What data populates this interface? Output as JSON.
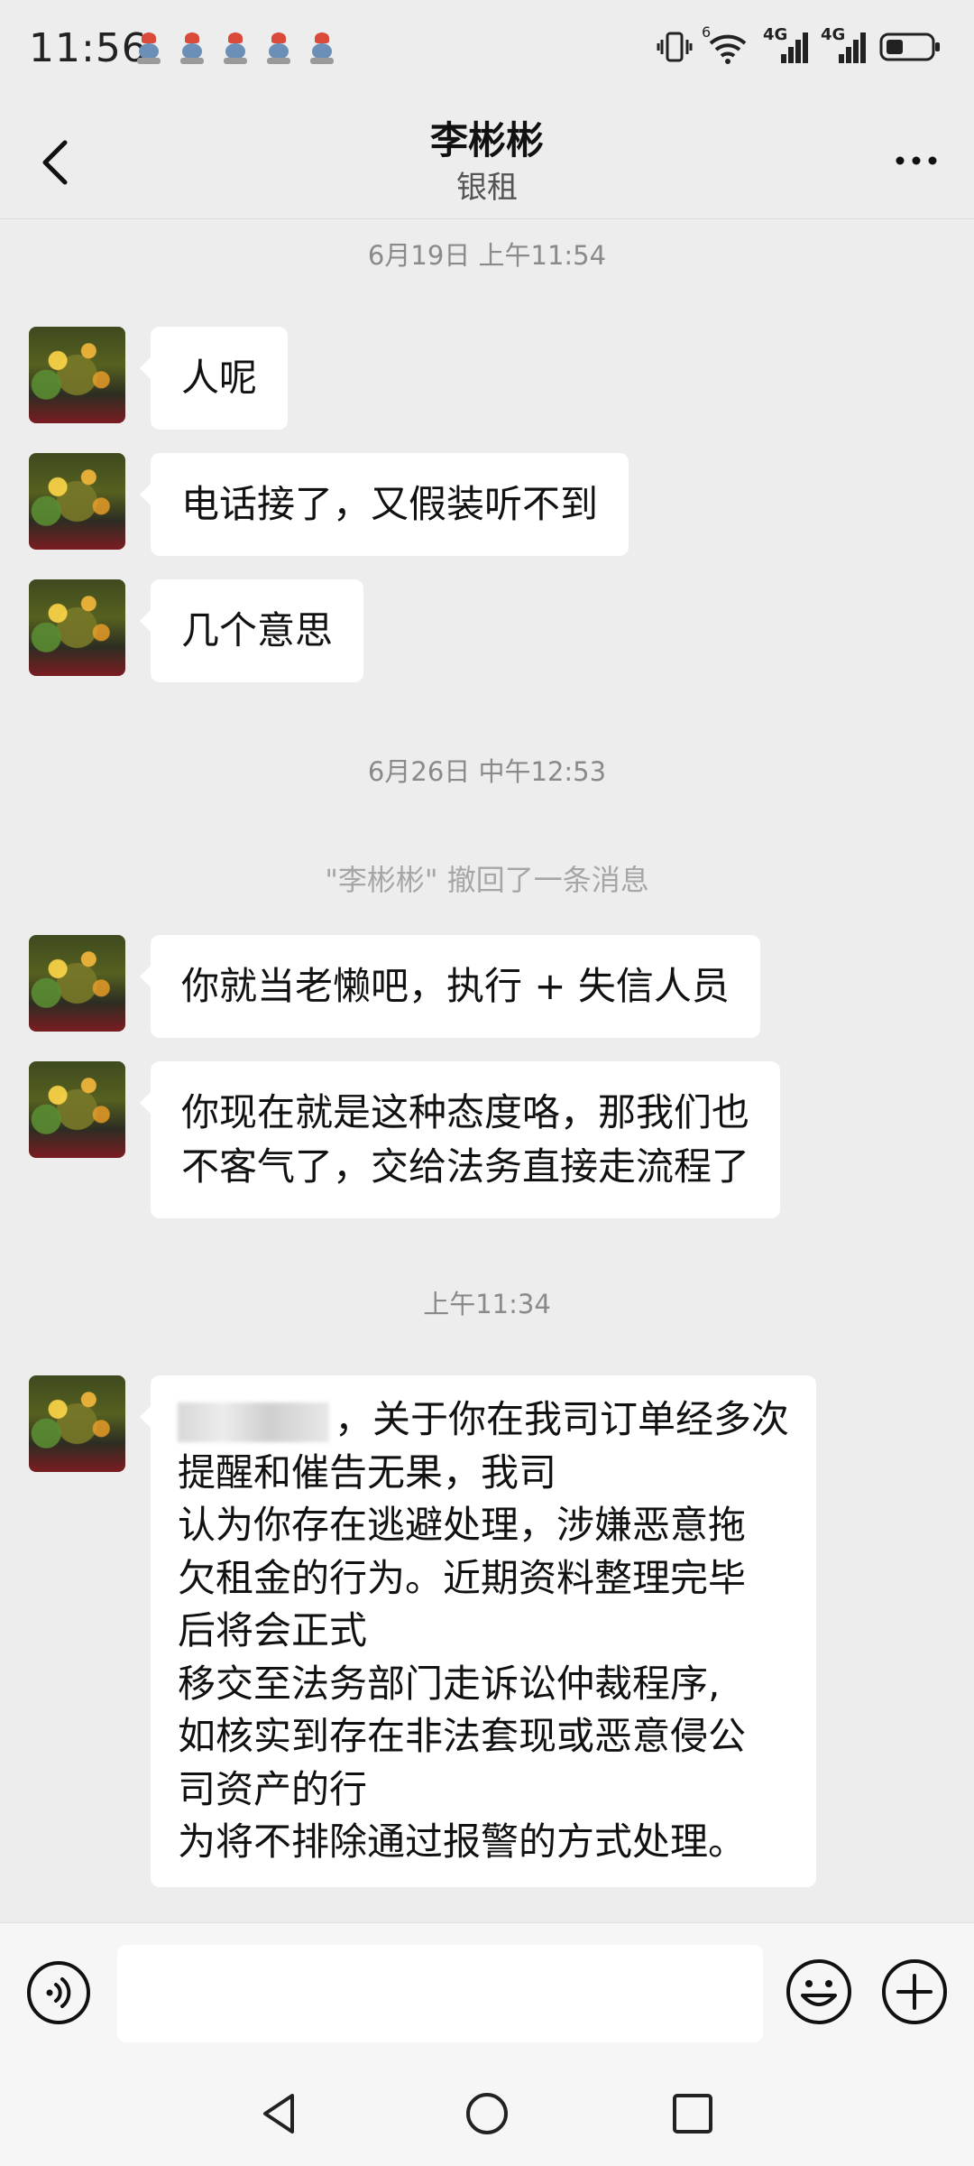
{
  "status_bar": {
    "time": "11:56",
    "signal1": "4G",
    "signal2": "4G",
    "wifi_badge": "6",
    "notification_icons": [
      "app-notification-icon",
      "app-notification-icon",
      "app-notification-icon",
      "app-notification-icon",
      "app-notification-icon"
    ]
  },
  "header": {
    "title": "李彬彬",
    "subtitle": "银租",
    "back_icon": "chevron-left-icon",
    "more_icon": "more-icon"
  },
  "chat": {
    "timestamp1": "6月19日 上午11:54",
    "msg1": "人呢",
    "msg2": "电话接了，又假装听不到",
    "msg3": "几个意思",
    "timestamp2": "6月26日 中午12:53",
    "recall_notice": "\"李彬彬\" 撤回了一条消息",
    "msg4": "你就当老懒吧，执行 + 失信人员",
    "msg5_line1": "你现在就是这种态度咯，那我们也",
    "msg5_line2": "不客气了，交给法务直接走流程了",
    "timestamp3": "上午11:34",
    "msg6_lines": [
      "，关于你在我司订单经多次",
      "提醒和催告无果，我司",
      "认为你存在逃避处理，涉嫌恶意拖",
      "欠租金的行为。近期资料整理完毕",
      "后将会正式",
      "移交至法务部门走诉讼仲裁程序,",
      "如核实到存在非法套现或恶意侵公",
      "司资产的行",
      "为将不排除通过报警的方式处理。"
    ]
  },
  "input_bar": {
    "voice_icon": "voice-icon",
    "emoji_icon": "emoji-icon",
    "plus_icon": "plus-icon",
    "input_value": ""
  },
  "nav_bar": {
    "back_icon": "nav-back-icon",
    "home_icon": "nav-home-icon",
    "recents_icon": "nav-recents-icon"
  }
}
